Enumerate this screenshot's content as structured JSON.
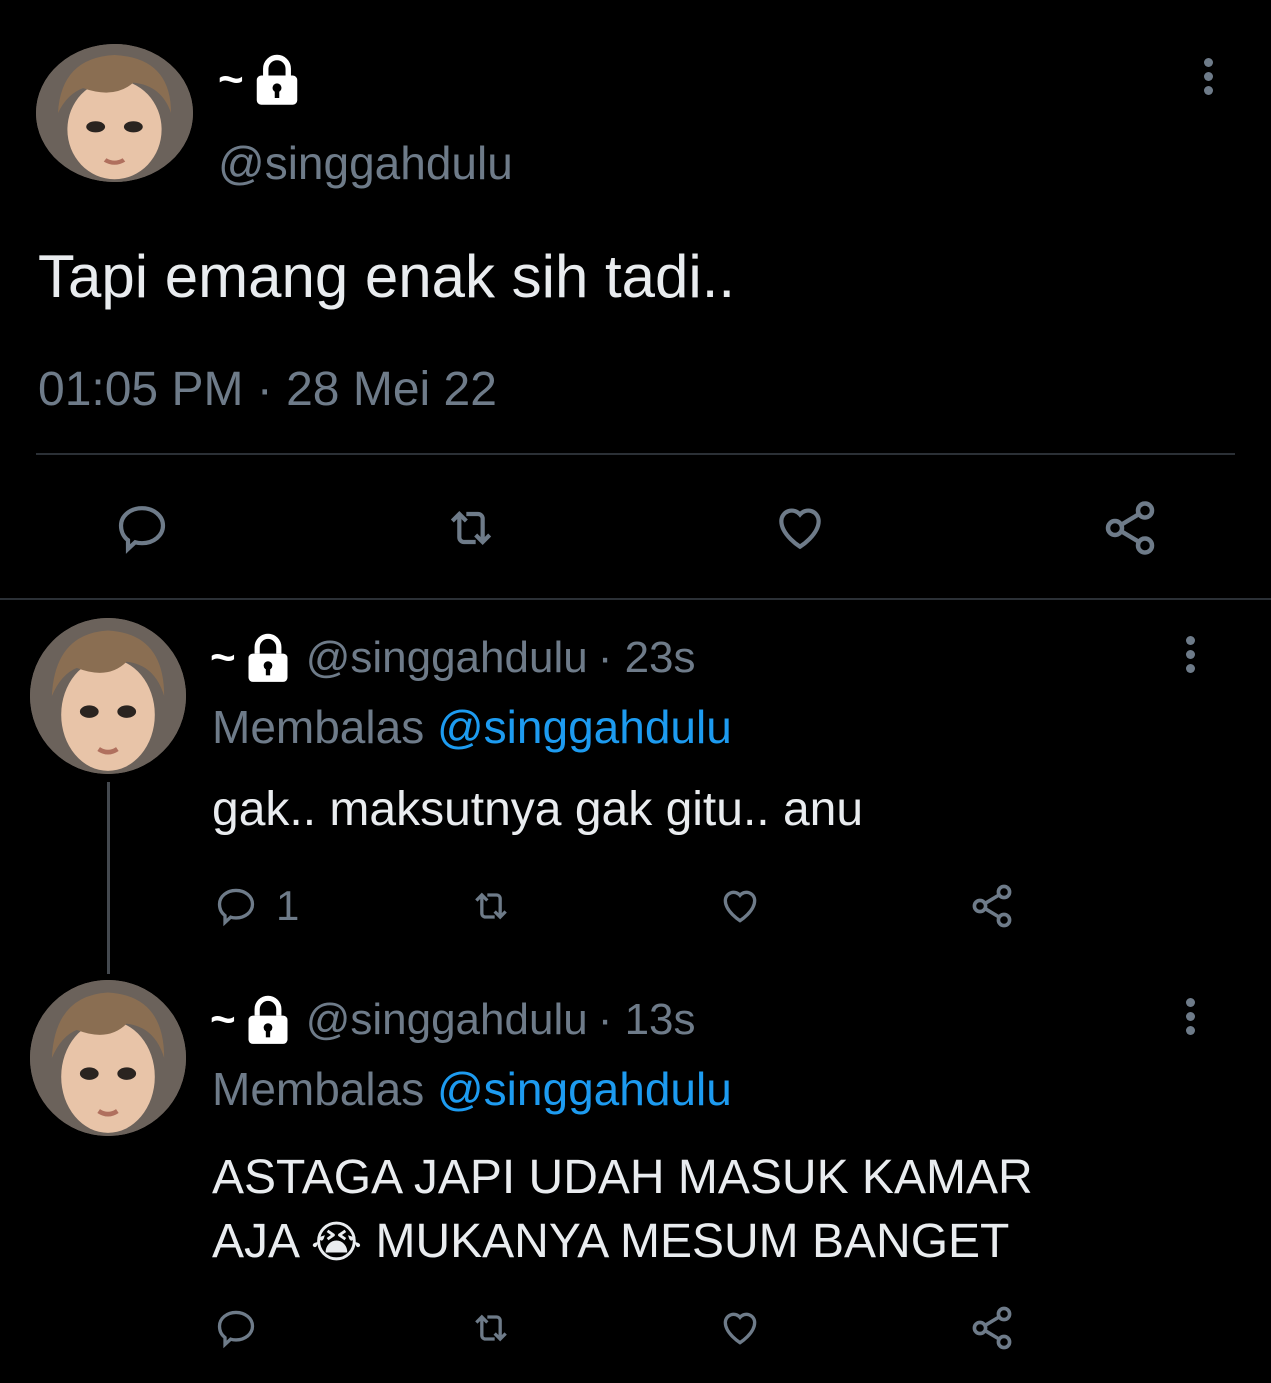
{
  "main_tweet": {
    "display_name": "~",
    "handle": "@singgahdulu",
    "text": "Tapi emang enak sih tadi..",
    "timestamp": "01:05 PM · 28 Mei 22",
    "avatar_icon": "profile-photo",
    "lock_icon": "lock-icon",
    "actions": [
      "reply-icon",
      "retweet-icon",
      "like-icon",
      "share-icon"
    ]
  },
  "replies": [
    {
      "display_name": "~",
      "handle": "@singgahdulu",
      "time": "· 23s",
      "replying_label": "Membalas",
      "replying_to": "@singgahdulu",
      "text_line1": "gak.. maksutnya gak gitu.. anu",
      "text_line2": "",
      "reply_count": "1"
    },
    {
      "display_name": "~",
      "handle": "@singgahdulu",
      "time": "· 13s",
      "replying_label": "Membalas",
      "replying_to": "@singgahdulu",
      "text_line1": "ASTAGA JAPI UDAH MASUK KAMAR",
      "text_line2_a": "AJA",
      "emoji": "😭",
      "text_line2_b": "MUKANYA MESUM BANGET",
      "reply_count": ""
    }
  ],
  "colors": {
    "background": "#000000",
    "text": "#ffffff",
    "muted": "#6e7b89",
    "link": "#1d9bf0",
    "divider": "#2b3036"
  }
}
